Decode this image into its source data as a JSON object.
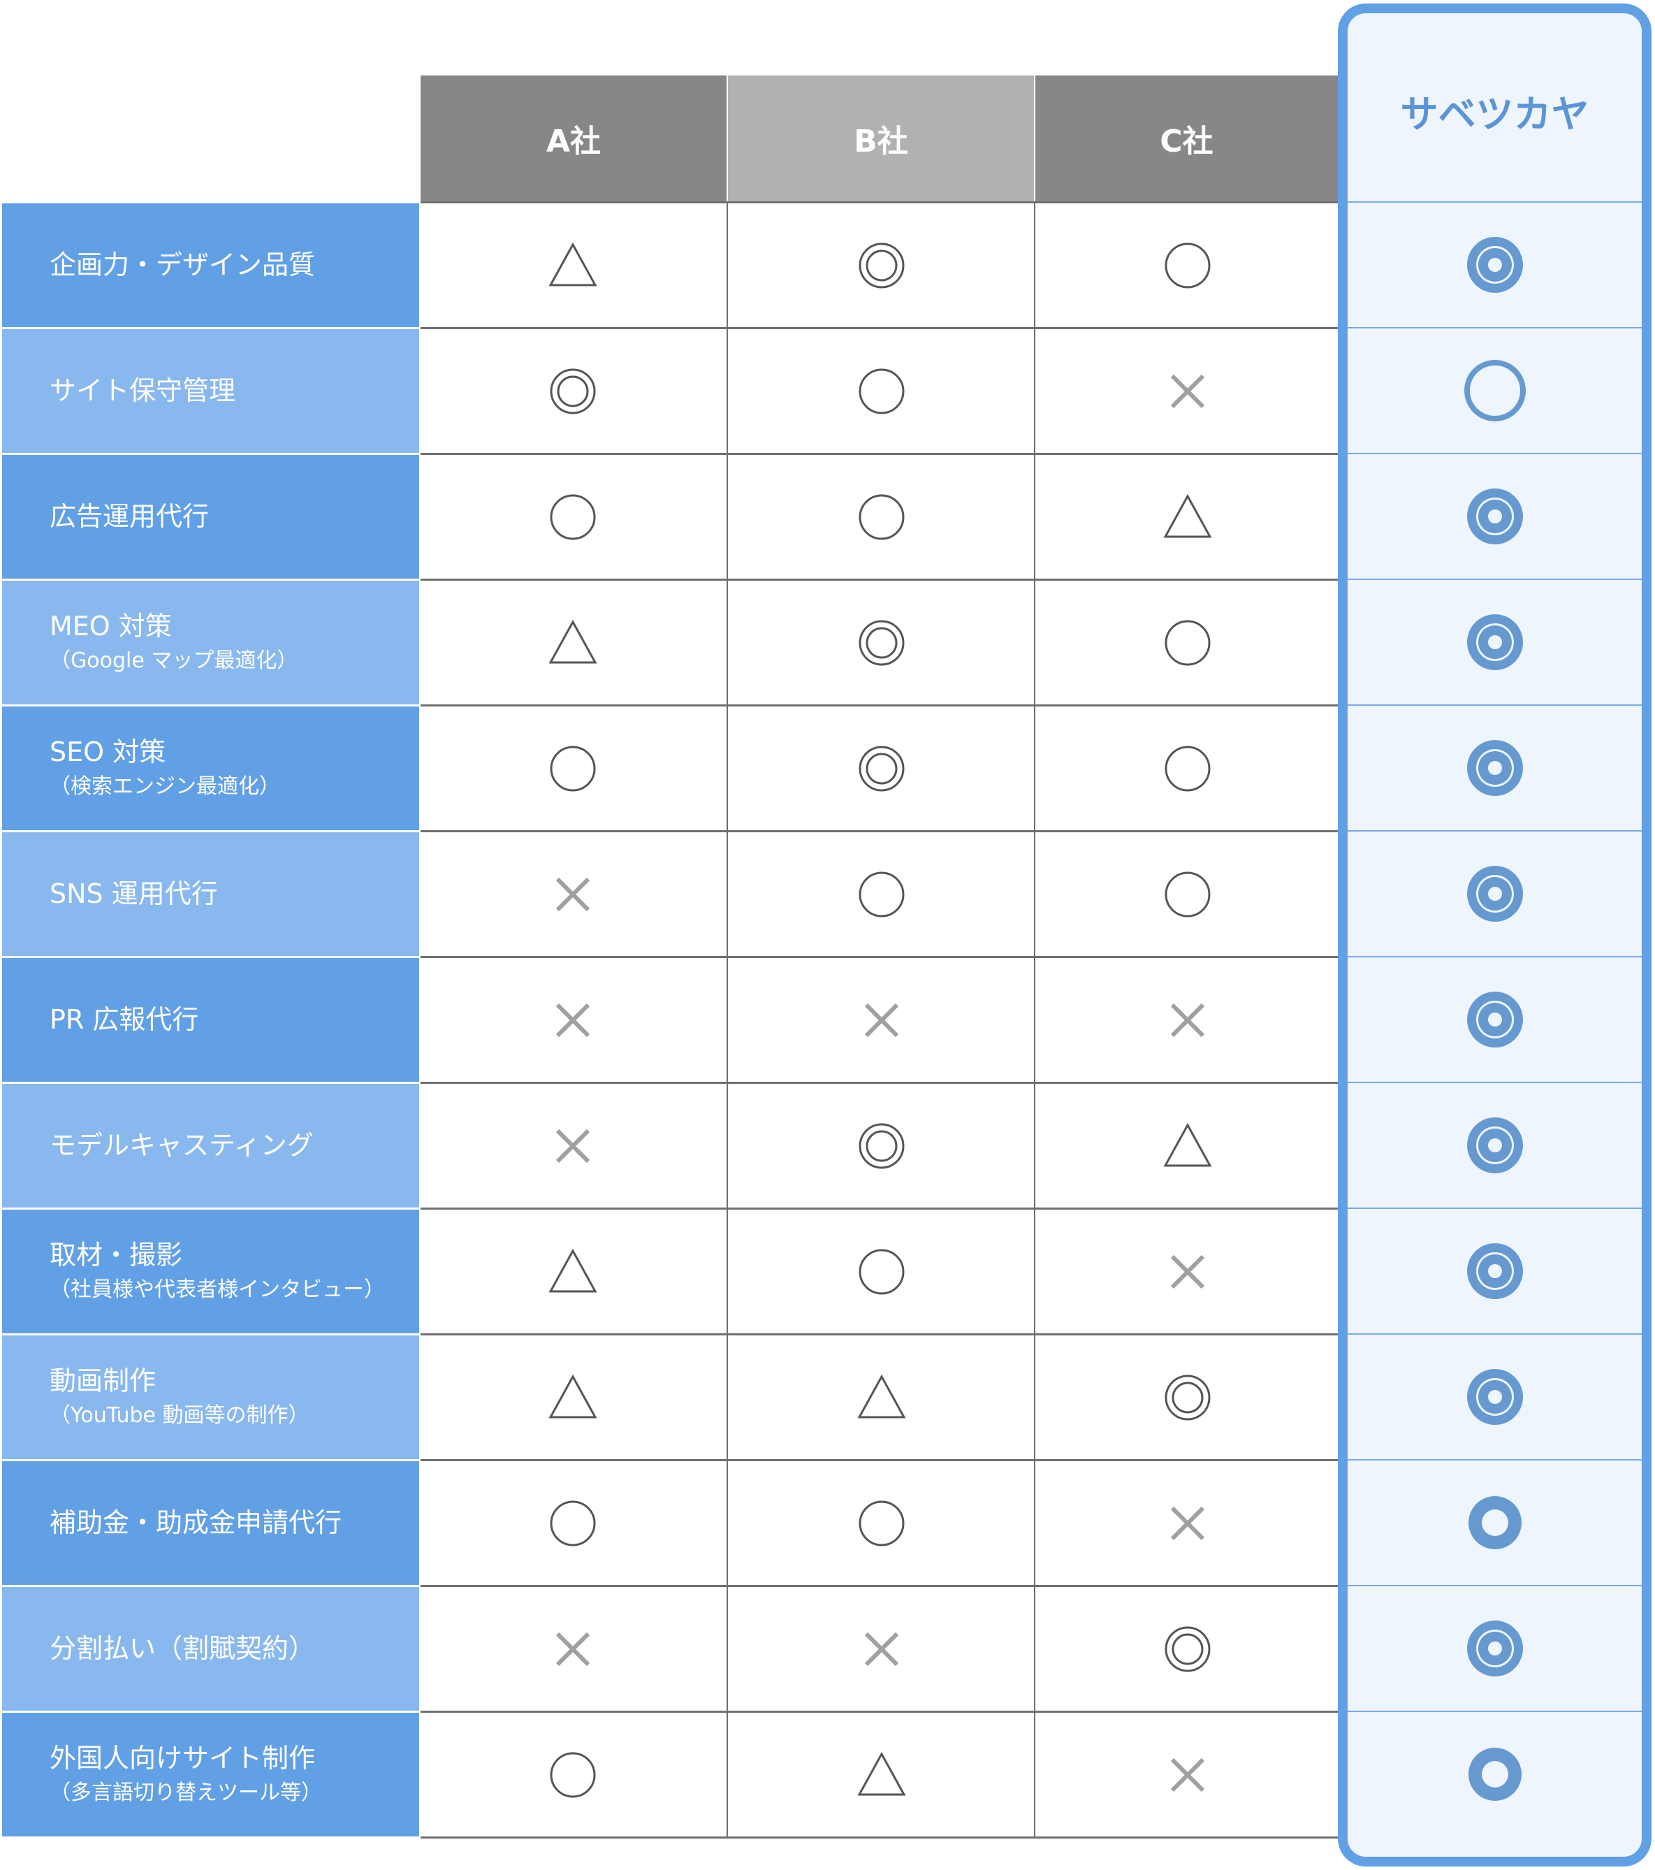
{
  "columns": {
    "a": "A社",
    "b": "B社",
    "c": "C社",
    "highlight": "サベツカヤ"
  },
  "colors": {
    "label_dark": "#62a0e6",
    "label_light": "#89b8ee",
    "header_dark": "#878787",
    "header_light": "#b1b1b1",
    "highlight_border": "#62a0e6",
    "highlight_bg": "#eef5fd",
    "highlight_mark": "#6699d0",
    "mark_dark": "#555555",
    "mark_cross": "#a0a0a0"
  },
  "legend_marks": {
    "double_circle": "◎",
    "circle": "○",
    "triangle": "△",
    "cross": "×"
  },
  "rows": [
    {
      "label": "企画力・デザイン品質",
      "sub": "",
      "a": "triangle",
      "b": "double_circle",
      "c": "circle",
      "highlight": "double_circle"
    },
    {
      "label": "サイト保守管理",
      "sub": "",
      "a": "double_circle",
      "b": "circle",
      "c": "cross",
      "highlight": "circle"
    },
    {
      "label": "広告運用代行",
      "sub": "",
      "a": "circle",
      "b": "circle",
      "c": "triangle",
      "highlight": "double_circle"
    },
    {
      "label": "MEO 対策",
      "sub": "（Google マップ最適化）",
      "a": "triangle",
      "b": "double_circle",
      "c": "circle",
      "highlight": "double_circle"
    },
    {
      "label": "SEO 対策",
      "sub": "（検索エンジン最適化）",
      "a": "circle",
      "b": "double_circle",
      "c": "circle",
      "highlight": "double_circle"
    },
    {
      "label": "SNS 運用代行",
      "sub": "",
      "a": "cross",
      "b": "circle",
      "c": "circle",
      "highlight": "double_circle"
    },
    {
      "label": "PR 広報代行",
      "sub": "",
      "a": "cross",
      "b": "cross",
      "c": "cross",
      "highlight": "double_circle"
    },
    {
      "label": "モデルキャスティング",
      "sub": "",
      "a": "cross",
      "b": "double_circle",
      "c": "triangle",
      "highlight": "double_circle"
    },
    {
      "label": "取材・撮影",
      "sub": "（社員様や代表者様インタビュー）",
      "a": "triangle",
      "b": "circle",
      "c": "cross",
      "highlight": "double_circle"
    },
    {
      "label": "動画制作",
      "sub": "（YouTube 動画等の制作）",
      "a": "triangle",
      "b": "triangle",
      "c": "double_circle",
      "highlight": "double_circle"
    },
    {
      "label": "補助金・助成金申請代行",
      "sub": "",
      "a": "circle",
      "b": "circle",
      "c": "cross",
      "highlight": "thick_circle"
    },
    {
      "label": "分割払い（割賦契約）",
      "sub": "",
      "a": "cross",
      "b": "cross",
      "c": "double_circle",
      "highlight": "double_circle"
    },
    {
      "label": "外国人向けサイト制作",
      "sub": "（多言語切り替えツール等）",
      "a": "circle",
      "b": "triangle",
      "c": "cross",
      "highlight": "thick_circle"
    }
  ]
}
